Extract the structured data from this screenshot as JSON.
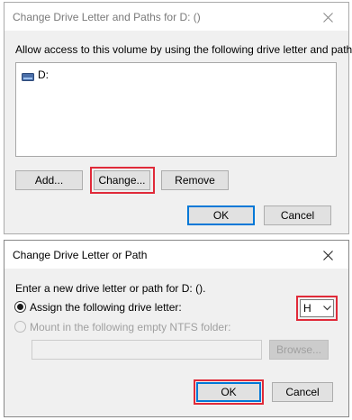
{
  "dialog1": {
    "title": "Change Drive Letter and Paths for D: ()",
    "description": "Allow access to this volume by using the following drive letter and paths:",
    "list_items": [
      {
        "label": "D:",
        "icon": "drive-icon"
      }
    ],
    "buttons": {
      "add": "Add...",
      "change": "Change...",
      "remove": "Remove",
      "ok": "OK",
      "cancel": "Cancel"
    }
  },
  "dialog2": {
    "title": "Change Drive Letter or Path",
    "description": "Enter a new drive letter or path for D: ().",
    "option_assign": "Assign the following drive letter:",
    "option_mount": "Mount in the following empty NTFS folder:",
    "selected_letter": "H",
    "folder_path": "",
    "buttons": {
      "browse": "Browse...",
      "ok": "OK",
      "cancel": "Cancel"
    }
  },
  "colors": {
    "highlight": "#e02a39",
    "accent": "#0078d7",
    "dialog_bg": "#f0f0f0"
  }
}
